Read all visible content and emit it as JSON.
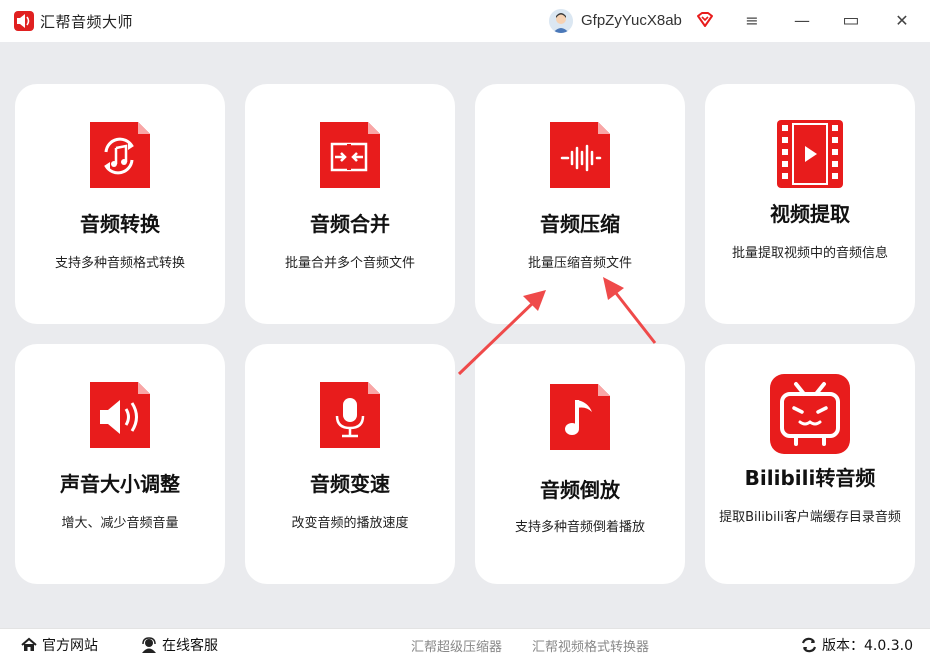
{
  "app": {
    "title": "汇帮音频大师",
    "username": "GfpZyYucX8ab"
  },
  "window_controls": {
    "menu": "≡",
    "minimize": "—",
    "maximize": "▭",
    "close": "✕"
  },
  "cards": [
    {
      "title": "音频转换",
      "desc": "支持多种音频格式转换",
      "icon": "audio-convert-icon"
    },
    {
      "title": "音频合并",
      "desc": "批量合并多个音频文件",
      "icon": "audio-merge-icon"
    },
    {
      "title": "音频压缩",
      "desc": "批量压缩音频文件",
      "icon": "audio-compress-icon"
    },
    {
      "title": "视频提取",
      "desc": "批量提取视频中的音频信息",
      "icon": "video-extract-icon"
    },
    {
      "title": "声音大小调整",
      "desc": "增大、减少音频音量",
      "icon": "volume-adjust-icon"
    },
    {
      "title": "音频变速",
      "desc": "改变音频的播放速度",
      "icon": "microphone-icon"
    },
    {
      "title": "音频倒放",
      "desc": "支持多种音频倒着播放",
      "icon": "music-note-icon"
    },
    {
      "title": "Bilibili转音频",
      "desc": "提取Bilibili客户端缓存目录音频",
      "icon": "bilibili-tv-icon"
    }
  ],
  "footer": {
    "website": "官方网站",
    "support": "在线客服",
    "link1": "汇帮超级压缩器",
    "link2": "汇帮视频格式转换器",
    "version": "版本：4.0.3.0"
  },
  "colors": {
    "accent": "#e81c1c",
    "background": "#eaebee",
    "annotation_arrow": "#ef4a4a"
  }
}
